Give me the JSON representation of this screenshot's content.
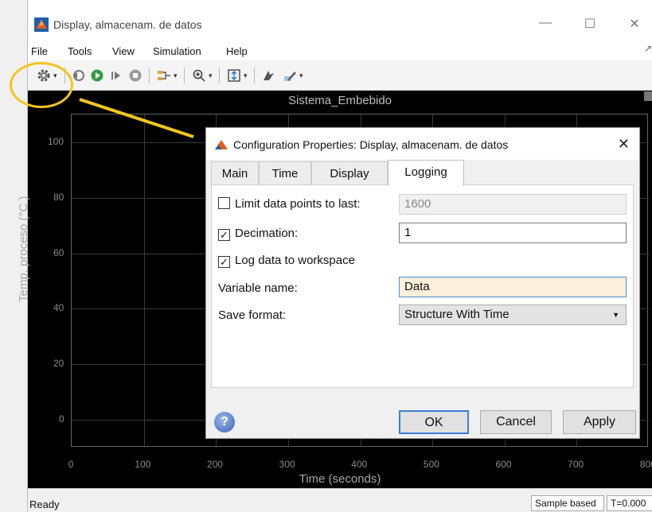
{
  "window": {
    "title": "Display, almacenam. de datos",
    "minimize": "—",
    "maximize": "☐",
    "close": "✕"
  },
  "menu": {
    "items": [
      "File",
      "Tools",
      "View",
      "Simulation",
      "Help"
    ],
    "pin": "↗"
  },
  "toolbar": {
    "icons": [
      "gear-icon",
      "step-back-icon",
      "run-icon",
      "step-forward-icon",
      "stop-icon",
      "signal-icon",
      "zoom-icon",
      "autoscale-icon",
      "highlight-icon",
      "edit-icon"
    ]
  },
  "plot": {
    "title": "Sistema_Embebido",
    "ylabel": "Temp. proceso (°C )",
    "xlabel": "Time (seconds)"
  },
  "chart_data": {
    "type": "line",
    "title": "Sistema_Embebido",
    "xlabel": "Time (seconds)",
    "ylabel": "Temp. proceso (°C )",
    "xlim": [
      0,
      800
    ],
    "ylim": [
      -10,
      110
    ],
    "xticks": [
      "0",
      "100",
      "200",
      "300",
      "400",
      "500",
      "600",
      "700",
      "800"
    ],
    "yticks": [
      "0",
      "20",
      "40",
      "60",
      "80",
      "100"
    ],
    "grid": true,
    "series": []
  },
  "status": {
    "ready": "Ready",
    "mode": "Sample based",
    "time": "T=0.000"
  },
  "dialog": {
    "title": "Configuration Properties: Display, almacenam. de datos",
    "close": "✕",
    "tabs": [
      "Main",
      "Time",
      "Display",
      "Logging"
    ],
    "active_tab": "Logging",
    "limit_label": "Limit data points to last:",
    "limit_checked": false,
    "limit_value": "1600",
    "decimation_label": "Decimation:",
    "decimation_checked": true,
    "decimation_value": "1",
    "log_label": "Log data to workspace",
    "log_checked": true,
    "varname_label": "Variable name:",
    "varname_value": "Data",
    "format_label": "Save format:",
    "format_value": "Structure With Time",
    "help": "?",
    "ok": "OK",
    "cancel": "Cancel",
    "apply": "Apply"
  },
  "colors": {
    "annotation": "#f3c51d",
    "plot_bg": "#000000",
    "focus": "#3c7fd8"
  }
}
